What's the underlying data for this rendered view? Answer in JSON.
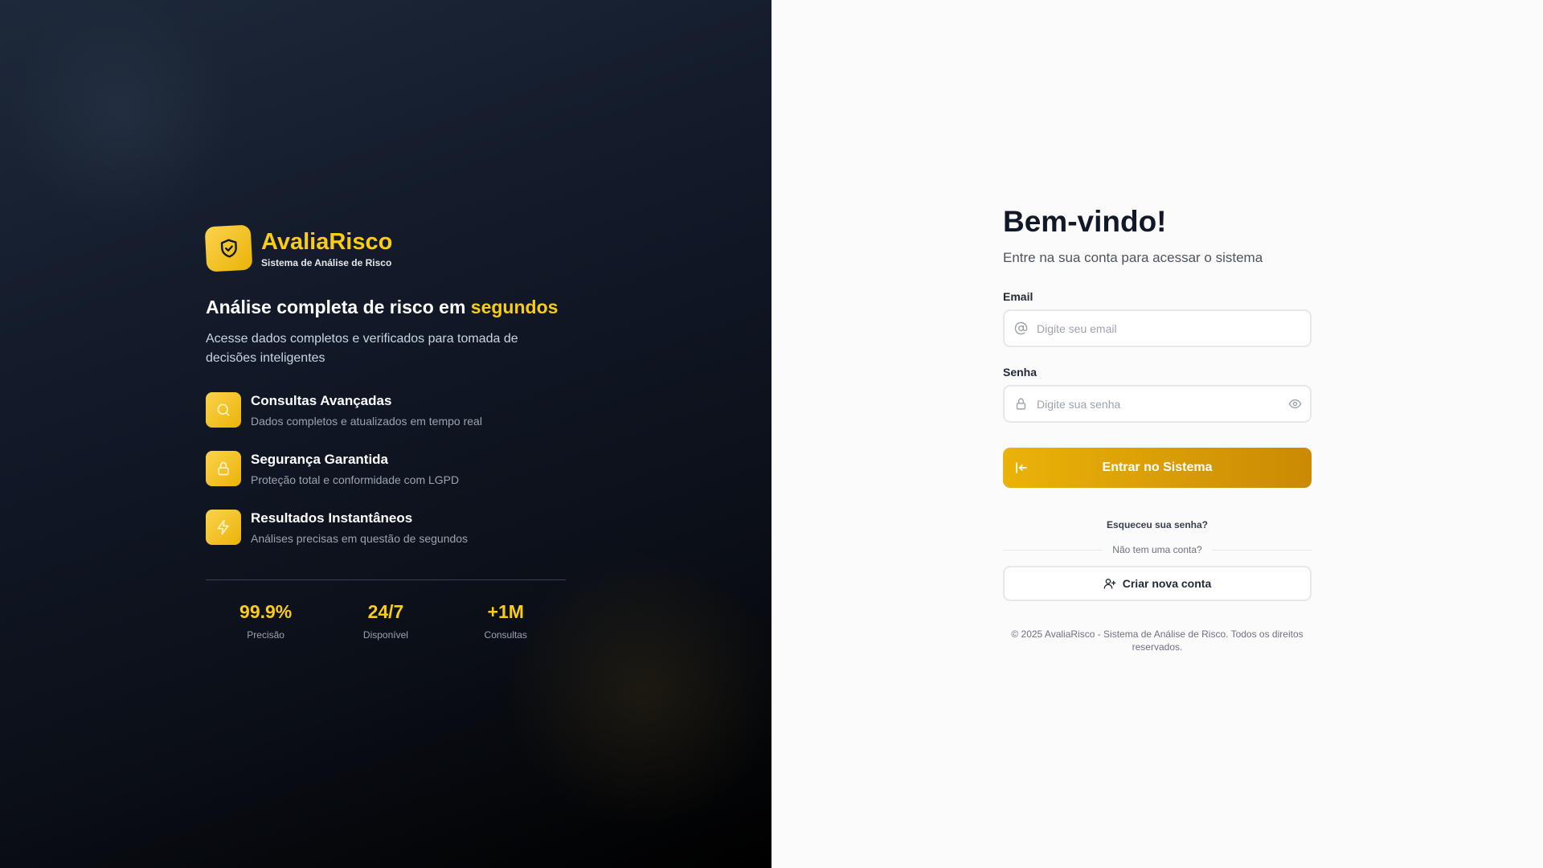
{
  "brand": {
    "name": "AvaliaRisco",
    "subtitle": "Sistema de Análise de Risco",
    "logo_icon": "shield-check-icon"
  },
  "hero": {
    "headline_prefix": "Análise completa de risco em ",
    "headline_accent": "segundos",
    "lead": "Acesse dados completos e verificados para tomada de decisões inteligentes"
  },
  "features": [
    {
      "icon": "search-icon",
      "title": "Consultas Avançadas",
      "description": "Dados completos e atualizados em tempo real"
    },
    {
      "icon": "lock-icon",
      "title": "Segurança Garantida",
      "description": "Proteção total e conformidade com LGPD"
    },
    {
      "icon": "bolt-icon",
      "title": "Resultados Instantâneos",
      "description": "Análises precisas em questão de segundos"
    }
  ],
  "stats": [
    {
      "value": "99.9%",
      "label": "Precisão"
    },
    {
      "value": "24/7",
      "label": "Disponível"
    },
    {
      "value": "+1M",
      "label": "Consultas"
    }
  ],
  "login": {
    "title": "Bem-vindo!",
    "subtitle": "Entre na sua conta para acessar o sistema",
    "email_label": "Email",
    "email_placeholder": "Digite seu email",
    "email_value": "",
    "password_label": "Senha",
    "password_placeholder": "Digite sua senha",
    "password_value": "",
    "submit_label": "Entrar no Sistema",
    "forgot_label": "Esqueceu sua senha?",
    "no_account_label": "Não tem uma conta?",
    "create_label": "Criar nova conta",
    "footer": "© 2025 AvaliaRisco - Sistema de Análise de Risco. Todos os direitos reservados."
  },
  "colors": {
    "accent": "#facc15",
    "accent_dark": "#ca8a04",
    "dark_bg": "#111827",
    "light_bg": "#fbfbfb"
  }
}
